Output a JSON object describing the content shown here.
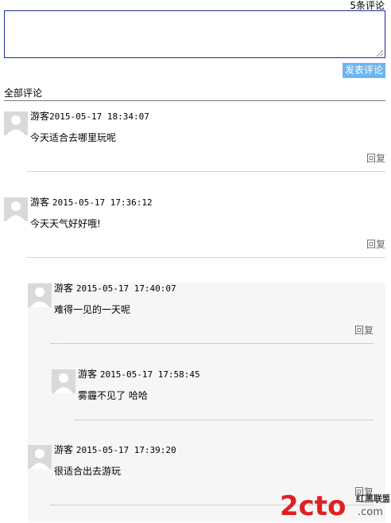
{
  "header": {
    "count_label": "5条评论"
  },
  "composer": {
    "value": "",
    "submit_label": "发表评论"
  },
  "section": {
    "title": "全部评论"
  },
  "comments": [
    {
      "user": "游客",
      "time": "2015-05-17 18:34:07",
      "text": "今天适合去哪里玩呢",
      "reply_label": "回复"
    },
    {
      "user": "游客",
      "time": "2015-05-17 17:36:12",
      "text": "今天天气好好哦!",
      "reply_label": "回复"
    },
    {
      "user": "游客",
      "time": "2015-05-17 17:40:07",
      "text": "难得一见的一天呢",
      "reply_label": "回复"
    },
    {
      "user": "游客",
      "time": "2015-05-17 17:58:45",
      "text": "雾霾不见了 哈哈",
      "reply_label": "回复"
    },
    {
      "user": "游客",
      "time": "2015-05-17 17:39:20",
      "text": "很适合出去游玩",
      "reply_label": "回复"
    }
  ],
  "watermark": {
    "brand": "2cto",
    "suffix": ".com",
    "cn": "红黑联盟"
  },
  "colors": {
    "submit_bg": "#6bb6f2",
    "textarea_border": "#1f2f8f",
    "nested_bg": "#f6f6f6",
    "watermark_red": "#e02020"
  }
}
